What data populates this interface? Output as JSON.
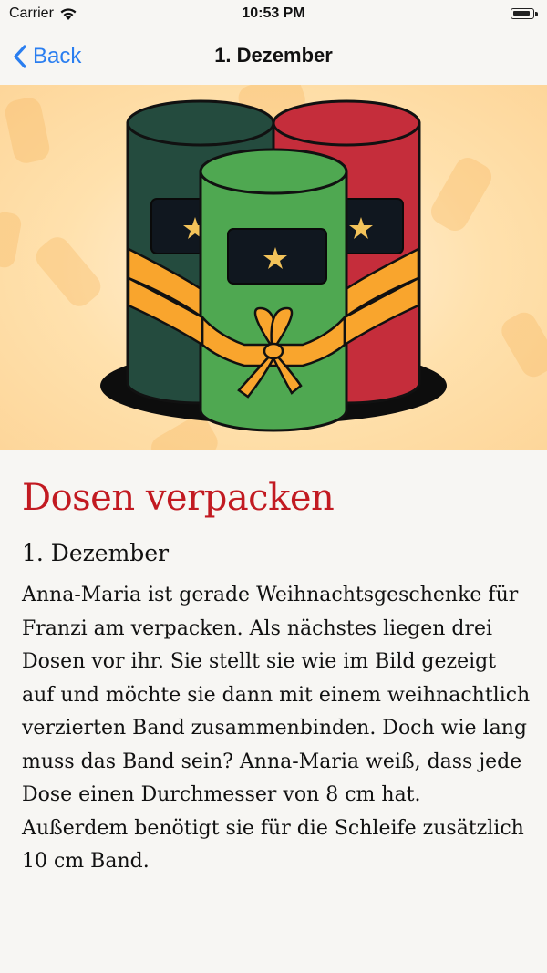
{
  "status_bar": {
    "carrier": "Carrier",
    "time": "10:53 PM",
    "wifi_icon": "wifi-icon",
    "battery_icon": "battery-icon"
  },
  "navbar": {
    "back_label": "Back",
    "back_icon": "chevron-left-icon",
    "title": "1. Dezember"
  },
  "colors": {
    "accent": "#2a7ef0",
    "title_red": "#c21a21",
    "hero_background": "#ffe1ad",
    "tin_dark_green": "#244b3e",
    "tin_red": "#c52d3b",
    "tin_green": "#4fa851",
    "ribbon_orange": "#f9a52d"
  },
  "article": {
    "title": "Dosen verpacken",
    "date": "1. Dezember",
    "body": "Anna-Maria ist gerade Weihnachtsgeschenke für Franzi am verpacken. Als nächstes liegen drei Dosen vor ihr. Sie stellt sie wie im Bild gezeigt auf und möchte sie dann mit einem weihnachtlich verzierten Band zusammenbinden. Doch wie lang muss das Band sein? Anna-Maria weiß, dass jede Dose einen Durchmesser von 8 cm hat. Außerdem benötigt sie für die Schleife zusätzlich 10 cm Band."
  }
}
